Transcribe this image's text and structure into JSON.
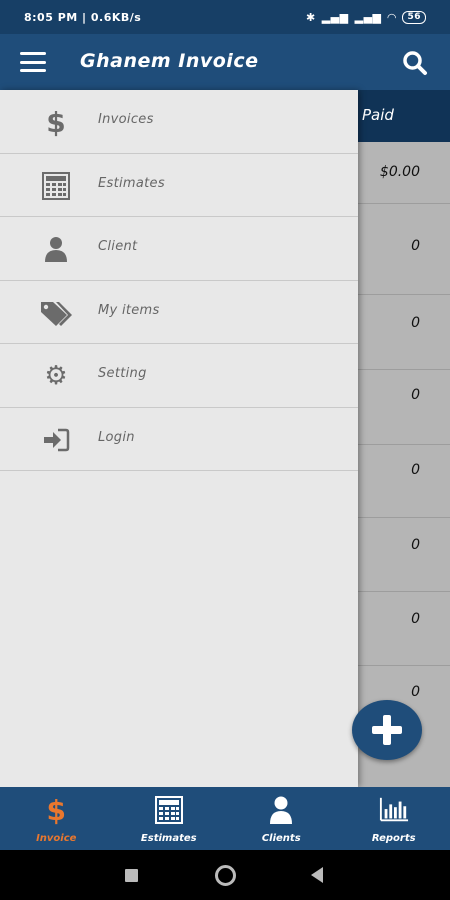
{
  "status_bar": {
    "left": "8:05 PM | 0.6KB/s",
    "battery": "56"
  },
  "app_bar": {
    "title": "Ghanem Invoice"
  },
  "table": {
    "paid_header": "Paid",
    "rows": [
      "$0.00",
      "0",
      "0",
      "0",
      "0",
      "0",
      "0",
      "0"
    ]
  },
  "drawer": {
    "items": [
      {
        "label": "Invoices",
        "icon": "dollar-icon"
      },
      {
        "label": "Estimates",
        "icon": "calculator-icon"
      },
      {
        "label": "Client",
        "icon": "user-icon"
      },
      {
        "label": "My items",
        "icon": "tags-icon"
      },
      {
        "label": "Setting",
        "icon": "gear-icon"
      },
      {
        "label": "Login",
        "icon": "login-icon"
      }
    ]
  },
  "bottom_nav": {
    "items": [
      {
        "label": "Invoice",
        "icon": "dollar-icon",
        "active": true
      },
      {
        "label": "Estimates",
        "icon": "calculator-icon"
      },
      {
        "label": "Clients",
        "icon": "user-icon"
      },
      {
        "label": "Reports",
        "icon": "bar-chart-icon"
      }
    ]
  },
  "colors": {
    "primary": "#1f4d7a",
    "accent": "#e8772e",
    "drawer_bg": "#e8e8e8"
  }
}
